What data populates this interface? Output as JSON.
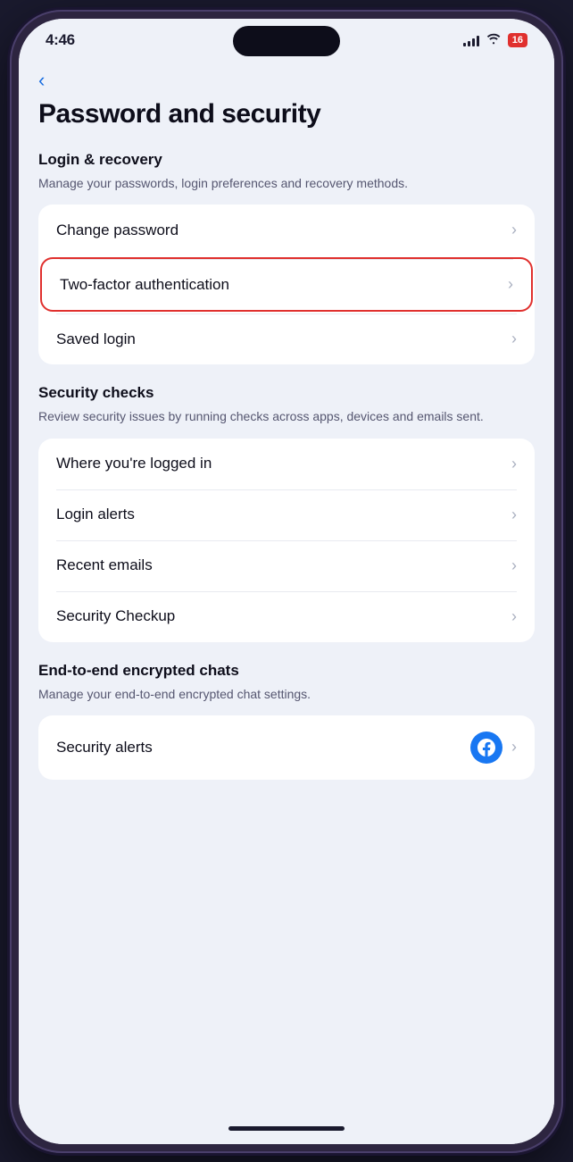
{
  "status_bar": {
    "time": "4:46",
    "battery_level": "16",
    "wifi": true,
    "signal_bars": [
      4,
      6,
      9,
      12
    ]
  },
  "back_button": {
    "label": "<"
  },
  "page": {
    "title": "Password and security"
  },
  "sections": [
    {
      "id": "login-recovery",
      "title": "Login & recovery",
      "description": "Manage your passwords, login preferences and recovery methods.",
      "items": [
        {
          "id": "change-password",
          "label": "Change password",
          "highlighted": false
        },
        {
          "id": "two-factor-auth",
          "label": "Two-factor authentication",
          "highlighted": true
        },
        {
          "id": "saved-login",
          "label": "Saved login",
          "highlighted": false
        }
      ]
    },
    {
      "id": "security-checks",
      "title": "Security checks",
      "description": "Review security issues by running checks across apps, devices and emails sent.",
      "items": [
        {
          "id": "where-logged-in",
          "label": "Where you're logged in",
          "highlighted": false
        },
        {
          "id": "login-alerts",
          "label": "Login alerts",
          "highlighted": false
        },
        {
          "id": "recent-emails",
          "label": "Recent emails",
          "highlighted": false
        },
        {
          "id": "security-checkup",
          "label": "Security Checkup",
          "highlighted": false
        }
      ]
    },
    {
      "id": "e2e-chats",
      "title": "End-to-end encrypted chats",
      "description": "Manage your end-to-end encrypted chat settings.",
      "items": [
        {
          "id": "security-alerts",
          "label": "Security alerts",
          "has_fb_icon": true,
          "highlighted": false
        }
      ]
    }
  ]
}
